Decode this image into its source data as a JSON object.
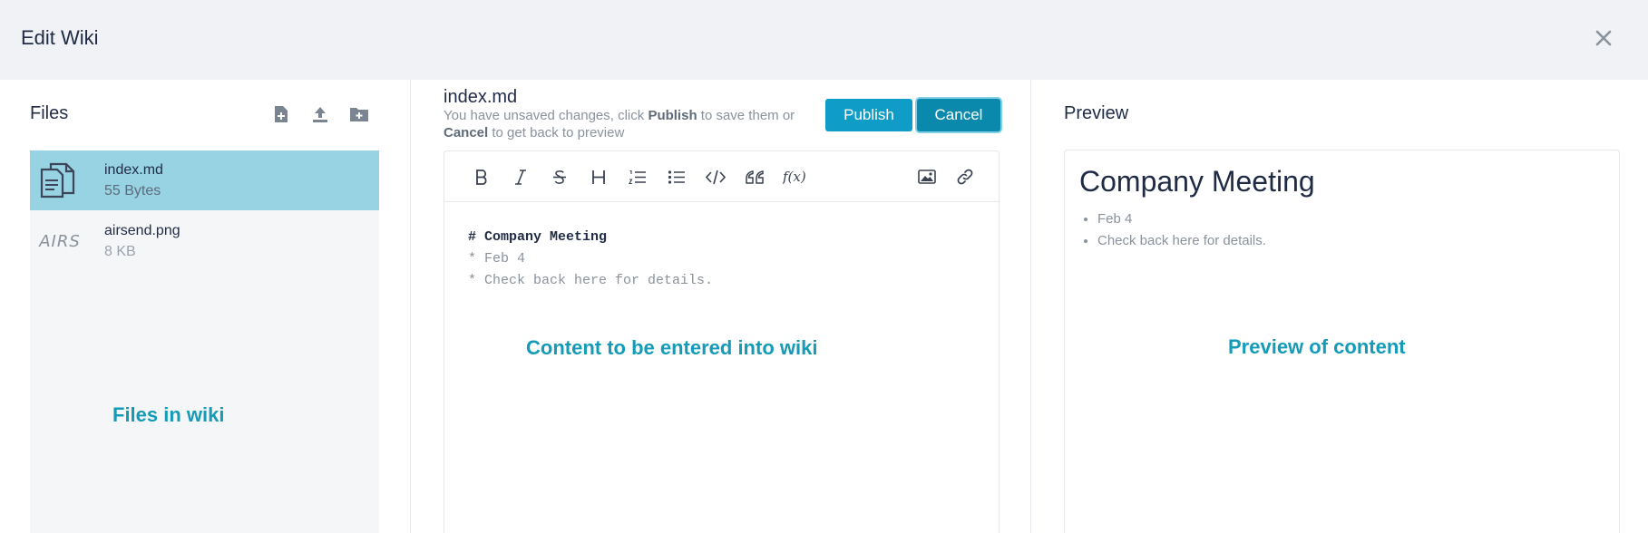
{
  "header": {
    "title": "Edit Wiki",
    "close_icon": "close-icon"
  },
  "files": {
    "title": "Files",
    "tools": [
      "new-file-icon",
      "upload-icon",
      "new-folder-icon"
    ],
    "items": [
      {
        "name": "index.md",
        "size": "55 Bytes",
        "icon": "document-icon",
        "selected": true
      },
      {
        "name": "airsend.png",
        "size": "8 KB",
        "thumb": "AIRS",
        "selected": false
      }
    ],
    "annotation": "Files in wiki"
  },
  "editor": {
    "filename": "index.md",
    "hint_prefix": "You have unsaved changes, click",
    "hint_publish": "Publish",
    "hint_middle": "to save them or",
    "hint_cancel": "Cancel",
    "hint_suffix": "to get back to preview",
    "publish_label": "Publish",
    "cancel_label": "Cancel",
    "toolbar": [
      "bold-icon",
      "italic-icon",
      "strikethrough-icon",
      "heading-icon",
      "ordered-list-icon",
      "bullet-list-icon",
      "code-icon",
      "quote-icon",
      "formula-icon",
      "image-icon",
      "link-icon"
    ],
    "lines": [
      "# Company Meeting",
      "* Feb 4",
      "* Check back here for details."
    ],
    "annotation": "Content to be entered into wiki"
  },
  "preview": {
    "title": "Preview",
    "heading": "Company Meeting",
    "items": [
      "Feb 4",
      "Check back here for details."
    ],
    "annotation": "Preview of content"
  },
  "colors": {
    "accent": "#0f9cc7",
    "selected_row": "#98d3e4",
    "annotation": "#149bb8",
    "header_bg": "#f0f2f5"
  }
}
